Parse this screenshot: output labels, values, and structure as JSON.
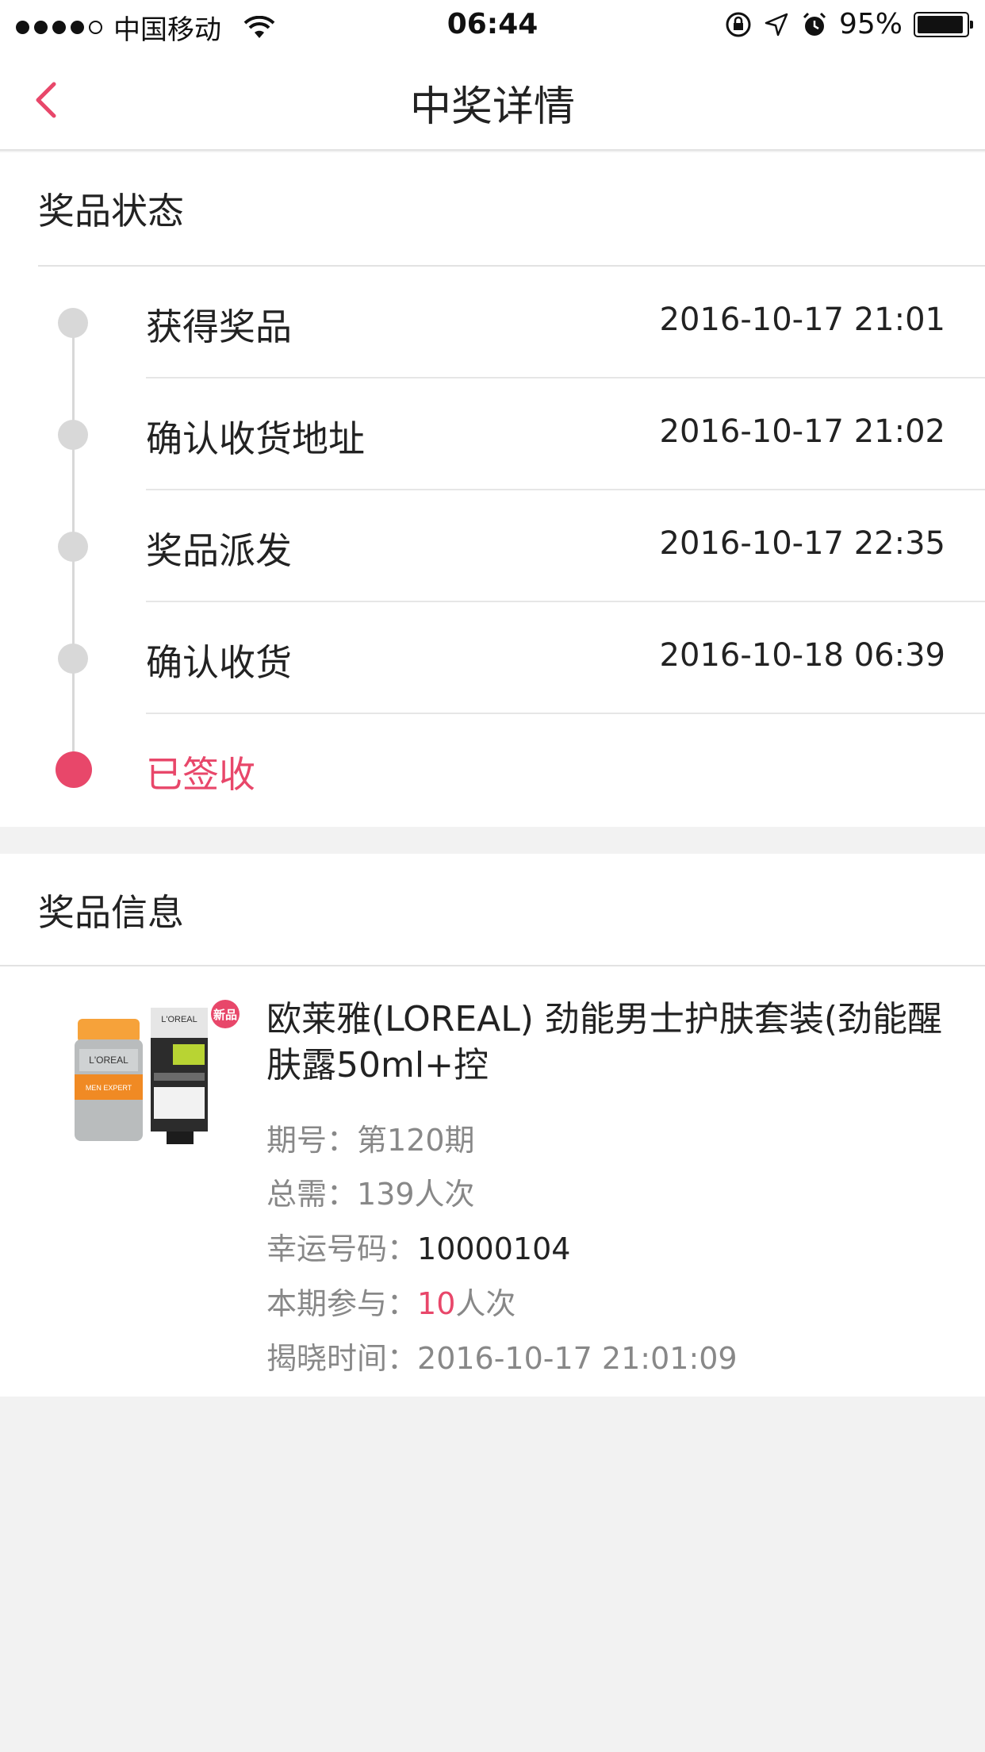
{
  "status_bar": {
    "carrier": "中国移动",
    "time": "06:44",
    "battery": "95%"
  },
  "nav": {
    "title": "中奖详情"
  },
  "prize_status": {
    "header": "奖品状态",
    "steps": [
      {
        "label": "获得奖品",
        "time": "2016-10-17 21:01"
      },
      {
        "label": "确认收货地址",
        "time": "2016-10-17 21:02"
      },
      {
        "label": "奖品派发",
        "time": "2016-10-17 22:35"
      },
      {
        "label": "确认收货",
        "time": "2016-10-18 06:39"
      },
      {
        "label": "已签收",
        "time": ""
      }
    ]
  },
  "prize_info": {
    "header": "奖品信息",
    "badge": "新品",
    "title": "欧莱雅(LOREAL) 劲能男士护肤套装(劲能醒肤露50ml+控",
    "period_label": "期号：",
    "period_value": "第120期",
    "total_label": "总需：",
    "total_value": "139人次",
    "lucky_label": "幸运号码：",
    "lucky_value": "10000104",
    "participation_label": "本期参与：",
    "participation_count": "10",
    "participation_unit": "人次",
    "reveal_label": "揭晓时间：",
    "reveal_value": "2016-10-17 21:01:09"
  },
  "colors": {
    "accent": "#e8476a",
    "timeline_gray": "#d8d8d8",
    "background": "#f2f2f2"
  }
}
